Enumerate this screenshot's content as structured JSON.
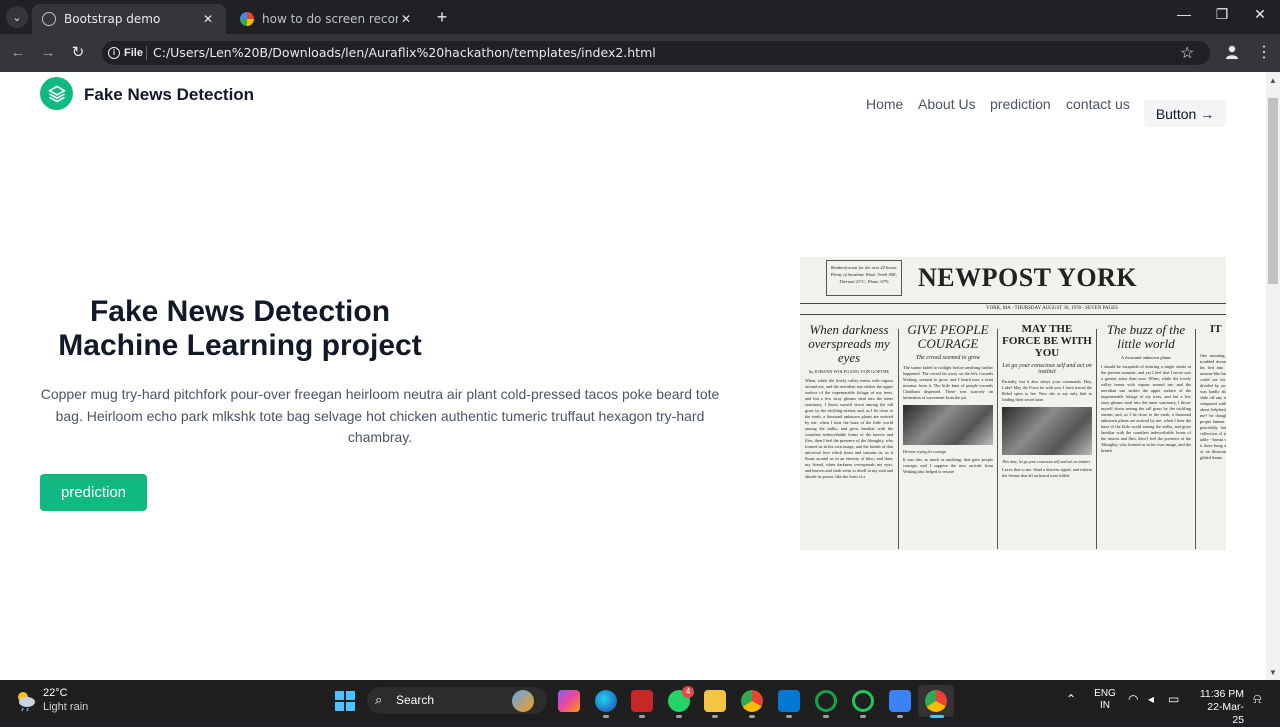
{
  "browser": {
    "tabs": [
      {
        "title": "Bootstrap demo",
        "active": true
      },
      {
        "title": "how to do screen recording in l",
        "active": false
      }
    ],
    "url_chip": "File",
    "url": "C:/Users/Len%20B/Downloads/len/Auraflix%20hackathon/templates/index2.html"
  },
  "page": {
    "brand": "Fake News Detection",
    "nav": {
      "home": "Home",
      "about": "About Us",
      "prediction": "prediction",
      "contact": "contact us",
      "button": "Button →"
    },
    "hero": {
      "title_line1": "Fake News Detection",
      "title_line2": "Machine Learning project",
      "text": "Copper mug try-hard pitchfork pour-over freegan heirloom neutra air plant cold-pressed tacos poke beard tote bag. Heirloom echo park mlkshk tote bag selvage hot chicken authentic tumeric truffaut hexagon try-hard chambray.",
      "button": "prediction"
    },
    "newspaper": {
      "masthead": "NEWPOST YORK",
      "weather": "Weatherforcast for the next 24 hours: Plenty of Sunshine Wind: 7mi/h SSE; Thermal 21°C; Plans: 67%",
      "dateline": "YORK, MA - THURSDAY AUGUST 30, 1978 - SEVEN PAGES",
      "col1": {
        "headline": "When darkness overspreads my eyes",
        "byline": "by JOHANN WOLFGANG VON GOETHE",
        "body": "When, while the lovely valley teems with vapour around me, and the meridian sun strikes the upper surface of the impenetrable foliage of my trees, and but a few stray gleams steal into the inner sanctuary, I throw myself down among the tall grass by the trickling stream; and, as I lie close to the earth, a thousand unknown plants are noticed by me: when I hear the buzz of the little world among the stalks, and grow familiar with the countless indescribable forms of the insects and flies, then I feel the presence of the Almighty, who formed us in his own image, and the breath of that universal love which bears and sustains us, as it floats around us in an eternity of bliss; and then, my friend, when darkness overspreads my eyes, and heaven and earth seem to dwell in my soul and absorb its power, like the form of a"
      },
      "col2": {
        "headline": "GIVE PEOPLE COURAGE",
        "subhead": "The crowd seemed to grow",
        "body": "The sunset faded to twilight before anything further happened. The crowd far away on the left, towards Woking, seemed to grow, and I heard now a faint murmur from it. The little knot of people towards Chobham dispersed. There was scarcely an intimation of movement from the pit.",
        "caption": "Heroine trying for courage",
        "body2": "It was this, as much as anything, that gave people courage, and I suppose the new arrivals from Woking also helped to restore"
      },
      "col3": {
        "headline": "MAY THE FORCE BE WITH YOU",
        "subhead": "Let go your conscious self and act on instinct",
        "body": "Partially, but it also obeys your commands. Hey, Luke! May the Force be with you. I have traced the Rebel spies to her. Now she is my only link to finding their secret base.",
        "caption": "This time, let go your conscious self and act on instinct",
        "body2": "Leave that to me. Send a distress signal, and inform the Senate that all on board were killed."
      },
      "col4": {
        "headline": "The buzz of the little world",
        "sub": "A thousand unknown plants",
        "body": "I should be incapable of drawing a single stroke at the present moment; and yet I feel that I never was a greater artist than now. When, while the lovely valley teems with vapour around me, and the meridian sun strikes the upper surface of the impenetrable foliage of my trees, and but a few stray gleams steal into the inner sanctuary, I throw myself down among the tall grass by the trickling stream; and, as I lie close to the earth, a thousand unknown plants are noticed by me: when I hear the buzz of the little world among the stalks, and grow familiar with the countless indescribable forms of the insects and flies, then I feel the presence of the Almighty, who formed us in his own image, and the breath"
      },
      "col5": {
        "headline": "IT",
        "body": "One morning, when Gregor Samsa woke from troubled dreams, he found himself transformed in his bed into a horrible vermin. He lay on his armour-like back, and if he lifted his head a little he could see his brown belly, slightly domed and divided by arches into stiff sections. The bedding was hardly able to cover it and seemed ready to slide off any moment. His many legs, pitifully thin compared with the size of the rest of him, waved about helplessly as he looked. What's happened to me? he thought. It wasn't a dream. His room, a proper human room although a little too small, lay peacefully between its four familiar walls. A collection of textile samples lay spread out on the table - Samsa was a travelling salesman - and above it there hung a picture that he had recently cut out of an illustrated magazine and housed in a nice, gilded frame."
      }
    }
  },
  "taskbar": {
    "weather_temp": "22°C",
    "weather_desc": "Light rain",
    "search": "Search",
    "whatsapp_badge": "4",
    "lang_top": "ENG",
    "lang_bottom": "IN",
    "time": "11:36 PM",
    "date": "22-Mar-25"
  }
}
